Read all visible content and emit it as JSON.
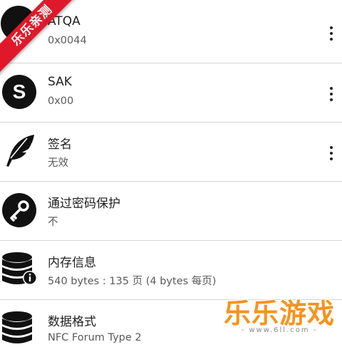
{
  "rows": [
    {
      "title": "ATQA",
      "subtitle": "0x0044",
      "icon": "atqa-icon",
      "has_menu": true
    },
    {
      "title": "SAK",
      "subtitle": "0x00",
      "icon": "sak-s-icon",
      "has_menu": true
    },
    {
      "title": "签名",
      "subtitle": "无效",
      "icon": "feather-icon",
      "has_menu": true
    },
    {
      "title": "通过密码保护",
      "subtitle": "不",
      "icon": "key-icon",
      "has_menu": false
    },
    {
      "title": "内存信息",
      "subtitle": "540 bytes : 135 页 (4 bytes 每页)",
      "icon": "database-info-icon",
      "has_menu": false
    },
    {
      "title": "数据格式",
      "subtitle": "NFC Forum Type 2",
      "icon": "database-icon",
      "has_menu": false
    }
  ],
  "watermark": {
    "ribbon_text": "乐乐亲测",
    "brand_name": "乐乐游戏",
    "brand_url": "- www.6ll.com -"
  },
  "colors": {
    "ribbon": "#e0192a",
    "brand": "#f7931e",
    "icon": "#111111"
  }
}
